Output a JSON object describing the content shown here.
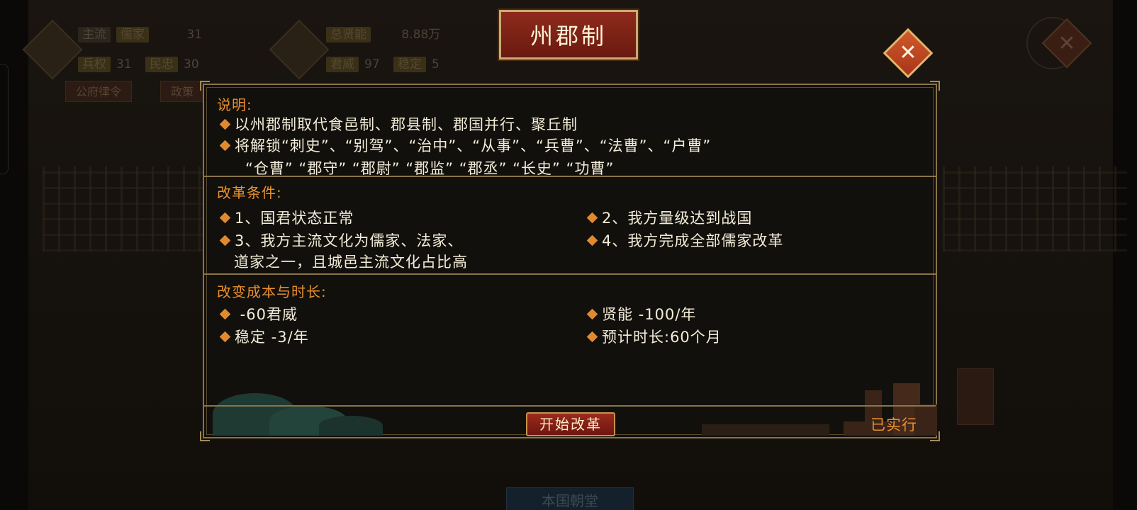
{
  "background": {
    "stats": [
      {
        "label": "主流",
        "chip": "儒家",
        "value": "31"
      },
      {
        "label": "兵权",
        "chip_value": "31",
        "label2": "民忠",
        "value": "30"
      },
      {
        "label": "总贤能",
        "value": "8.88万"
      },
      {
        "label": "君威",
        "chip_value": "97",
        "label2": "稳定",
        "value": "5"
      }
    ],
    "buttons": [
      "公府律令",
      "政策"
    ],
    "bottom_tab": "本国朝堂"
  },
  "dialog": {
    "title": "州郡制",
    "close_icon": "✕",
    "description": {
      "title": "说明:",
      "lines": [
        "以州郡制取代食邑制、郡县制、郡国并行、聚丘制",
        "将解锁“刺史”、“别驾”、“治中”、“从事”、“兵曹”、“法曹”、“户曹”",
        "“仓曹” “郡守” “郡尉” “郡监” “郡丞” “长史” “功曹”"
      ]
    },
    "conditions": {
      "title": "改革条件:",
      "items": [
        "1、国君状态正常",
        "2、我方量级达到战国",
        "3、我方主流文化为儒家、法家、",
        "道家之一，且城邑主流文化占比高",
        "4、我方完成全部儒家改革"
      ]
    },
    "cost": {
      "title": "改变成本与时长:",
      "items": [
        " -60君威",
        "贤能 -100/年",
        "稳定 -3/年",
        "预计时长:60个月"
      ]
    },
    "start_button": "开始改革",
    "status": "已实行"
  },
  "colors": {
    "accent": "#e8902f",
    "border": "#8a7448",
    "button": "#9a2a1d"
  }
}
